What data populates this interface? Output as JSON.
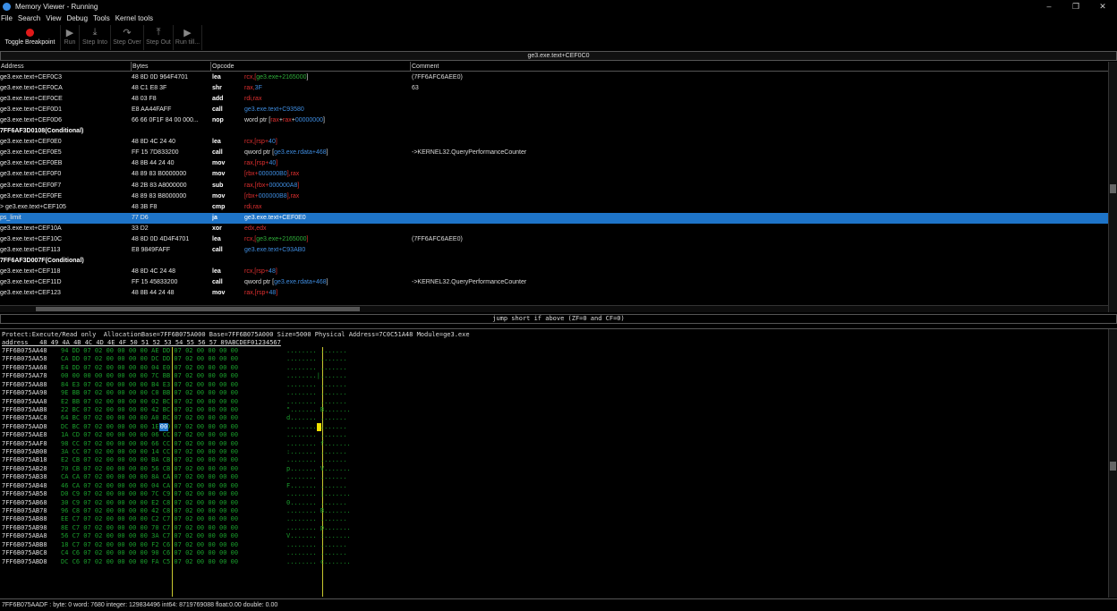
{
  "window": {
    "title": "Memory Viewer - Running",
    "minimize": "–",
    "restore": "❐",
    "close": "✕"
  },
  "menu": [
    "File",
    "Search",
    "View",
    "Debug",
    "Tools",
    "Kernel tools"
  ],
  "toolbar": [
    {
      "label": "Toggle Breakpoint",
      "icon": "breakpoint-icon",
      "glyph": ""
    },
    {
      "label": "Run",
      "icon": "run-icon",
      "glyph": "▶"
    },
    {
      "label": "Step Into",
      "icon": "step-into-icon",
      "glyph": "⤓"
    },
    {
      "label": "Step Over",
      "icon": "step-over-icon",
      "glyph": "↷"
    },
    {
      "label": "Step Out",
      "icon": "step-out-icon",
      "glyph": "⤒"
    },
    {
      "label": "Run till...",
      "icon": "run-till-icon",
      "glyph": "▶"
    }
  ],
  "disasm": {
    "title": "ge3.exe.text+CEF0C0",
    "headers": [
      "Address",
      "Bytes",
      "Opcode",
      "Comment"
    ],
    "rows": [
      {
        "type": "ins",
        "addr": "ge3.exe.text+CEF0C3",
        "bytes": "48 8D 0D 964F4701",
        "op": "lea",
        "args": [
          [
            "rcx,[",
            "reg"
          ],
          [
            "ge3.exe+2165000",
            "sym"
          ],
          [
            "]",
            "plain"
          ]
        ],
        "comment": "(7FF6AFC6AEE0)"
      },
      {
        "type": "ins",
        "addr": "ge3.exe.text+CEF0CA",
        "bytes": "48 C1 E8 3F",
        "op": "shr",
        "args": [
          [
            "rax,",
            "reg"
          ],
          [
            "3F",
            "num"
          ]
        ],
        "comment": "63"
      },
      {
        "type": "ins",
        "addr": "ge3.exe.text+CEF0CE",
        "bytes": "48 03 F8",
        "op": "add",
        "args": [
          [
            "rdi,rax",
            "reg"
          ]
        ],
        "comment": ""
      },
      {
        "type": "ins",
        "addr": "ge3.exe.text+CEF0D1",
        "bytes": "E8 AA44FAFF",
        "op": "call",
        "args": [
          [
            "ge3.exe.text+C93580",
            "num"
          ]
        ],
        "comment": ""
      },
      {
        "type": "ins",
        "addr": "ge3.exe.text+CEF0D6",
        "bytes": "66 66 0F1F 84 00 000...",
        "op": "nop",
        "args": [
          [
            "word ptr [",
            "plain"
          ],
          [
            "rax",
            "reg"
          ],
          [
            "+",
            "plain"
          ],
          [
            "rax",
            "reg"
          ],
          [
            "+",
            "plain"
          ],
          [
            "00000000",
            "num"
          ],
          [
            "]",
            "plain"
          ]
        ],
        "comment": ""
      },
      {
        "type": "label",
        "text": "7FF6AF3D0108(Conditional)"
      },
      {
        "type": "ins",
        "addr": "ge3.exe.text+CEF0E0",
        "bytes": "48 8D 4C 24 40",
        "op": "lea",
        "args": [
          [
            "rcx,[rsp+",
            "reg"
          ],
          [
            "40",
            "num"
          ],
          [
            "]",
            "reg"
          ]
        ],
        "comment": ""
      },
      {
        "type": "ins",
        "addr": "ge3.exe.text+CEF0E5",
        "bytes": "FF 15 7D833200",
        "op": "call",
        "args": [
          [
            "qword ptr [",
            "plain"
          ],
          [
            "ge3.exe.rdata+468",
            "num"
          ],
          [
            "]",
            "plain"
          ]
        ],
        "comment": "->KERNEL32.QueryPerformanceCounter"
      },
      {
        "type": "ins",
        "addr": "ge3.exe.text+CEF0EB",
        "bytes": "48 8B 44 24 40",
        "op": "mov",
        "args": [
          [
            "rax,[rsp+",
            "reg"
          ],
          [
            "40",
            "num"
          ],
          [
            "]",
            "reg"
          ]
        ],
        "comment": ""
      },
      {
        "type": "ins",
        "addr": "ge3.exe.text+CEF0F0",
        "bytes": "48 89 83 B0000000",
        "op": "mov",
        "args": [
          [
            "[rbx+",
            "reg"
          ],
          [
            "000000B0",
            "num"
          ],
          [
            "],rax",
            "reg"
          ]
        ],
        "comment": ""
      },
      {
        "type": "ins",
        "addr": "ge3.exe.text+CEF0F7",
        "bytes": "48 2B 83 A8000000",
        "op": "sub",
        "args": [
          [
            "rax,[rbx+",
            "reg"
          ],
          [
            "000000A8",
            "num"
          ],
          [
            "]",
            "reg"
          ]
        ],
        "comment": ""
      },
      {
        "type": "ins",
        "addr": "ge3.exe.text+CEF0FE",
        "bytes": "48 89 83 B8000000",
        "op": "mov",
        "args": [
          [
            "[rbx+",
            "reg"
          ],
          [
            "000000B8",
            "num"
          ],
          [
            "],rax",
            "reg"
          ]
        ],
        "comment": ""
      },
      {
        "type": "ins",
        "addr": "> ge3.exe.text+CEF105",
        "bytes": "48 3B F8",
        "op": "cmp",
        "args": [
          [
            "rdi,rax",
            "reg"
          ]
        ],
        "comment": ""
      },
      {
        "type": "ins",
        "sel": true,
        "addr": "ps_limit",
        "bytes": "77 D6",
        "op": "ja",
        "args": [
          [
            "ge3.exe.text+CEF0E0",
            "plain"
          ]
        ],
        "comment": ""
      },
      {
        "type": "ins",
        "addr": "ge3.exe.text+CEF10A",
        "bytes": "33 D2",
        "op": "xor",
        "args": [
          [
            "edx,edx",
            "reg"
          ]
        ],
        "comment": ""
      },
      {
        "type": "ins",
        "addr": "ge3.exe.text+CEF10C",
        "bytes": "48 8D 0D 4D4F4701",
        "op": "lea",
        "args": [
          [
            "rcx,[",
            "reg"
          ],
          [
            "ge3.exe+2165000",
            "sym"
          ],
          [
            "]",
            "reg"
          ]
        ],
        "comment": "(7FF6AFC6AEE0)"
      },
      {
        "type": "ins",
        "addr": "ge3.exe.text+CEF113",
        "bytes": "E8 9849FAFF",
        "op": "call",
        "args": [
          [
            "ge3.exe.text+C93AB0",
            "num"
          ]
        ],
        "comment": ""
      },
      {
        "type": "label",
        "text": "7FF6AF3D007F(Conditional)"
      },
      {
        "type": "ins",
        "addr": "ge3.exe.text+CEF118",
        "bytes": "48 8D 4C 24 48",
        "op": "lea",
        "args": [
          [
            "rcx,[rsp+",
            "reg"
          ],
          [
            "48",
            "num"
          ],
          [
            "]",
            "reg"
          ]
        ],
        "comment": ""
      },
      {
        "type": "ins",
        "addr": "ge3.exe.text+CEF11D",
        "bytes": "FF 15 45833200",
        "op": "call",
        "args": [
          [
            "qword ptr [",
            "plain"
          ],
          [
            "ge3.exe.rdata+468",
            "num"
          ],
          [
            "]",
            "plain"
          ]
        ],
        "comment": "->KERNEL32.QueryPerformanceCounter"
      },
      {
        "type": "ins",
        "addr": "ge3.exe.text+CEF123",
        "bytes": "48 8B 44 24 48",
        "op": "mov",
        "args": [
          [
            "rax,[rsp+",
            "reg"
          ],
          [
            "48",
            "num"
          ],
          [
            "]",
            "reg"
          ]
        ],
        "comment": ""
      }
    ]
  },
  "instruction_hint": "jump short if above (ZF=0 and CF=0)",
  "hex": {
    "info": "Protect:Execute/Read only  AllocationBase=7FF6B075A000 Base=7FF6B075A000 Size=5000 Physical Address=7C0C51A48 Module=ge3.exe",
    "header": "address   48 49 4A 4B 4C 4D 4E 4F 50 51 52 53 54 55 56 57 89ABCDEF01234567",
    "cursor_byte": "00",
    "rows": [
      {
        "addr": "7FF6B075AA48",
        "bytes": "94 DD 07 02 00 00 00 00 AE DD 07 02 00 00 00 00",
        "ascii": "........ ......."
      },
      {
        "addr": "7FF6B075AA58",
        "bytes": "CA DD 07 02 00 00 00 00 DC DD 07 02 00 00 00 00",
        "ascii": "........ ......."
      },
      {
        "addr": "7FF6B075AA68",
        "bytes": "E4 DD 07 02 00 00 00 00 04 E0 07 02 00 00 00 00",
        "ascii": "........ ......."
      },
      {
        "addr": "7FF6B075AA78",
        "bytes": "00 00 00 00 00 00 00 00 7C BB 07 02 00 00 00 00",
        "ascii": "........|......."
      },
      {
        "addr": "7FF6B075AA88",
        "bytes": "84 E3 07 02 00 00 00 00 B4 E3 07 02 00 00 00 00",
        "ascii": "........ ......."
      },
      {
        "addr": "7FF6B075AA98",
        "bytes": "9E BB 07 02 00 00 00 00 C0 BB 07 02 00 00 00 00",
        "ascii": "........ ......."
      },
      {
        "addr": "7FF6B075AAA8",
        "bytes": "E2 BB 07 02 00 00 00 00 02 BC 07 02 00 00 00 00",
        "ascii": "........ ......."
      },
      {
        "addr": "7FF6B075AAB8",
        "bytes": "22 BC 07 02 00 00 00 00 42 BC 07 02 00 00 00 00",
        "ascii": "\"....... B......."
      },
      {
        "addr": "7FF6B075AAC8",
        "bytes": "64 BC 07 02 00 00 00 00 A0 BC 07 02 00 00 00 00",
        "ascii": "d....... ......."
      },
      {
        "addr": "7FF6B075AAD8",
        "bytes": "DC BC 07 02 00 00 00 00 1E BD 07 02 00 00 00 00",
        "ascii": "........ ......."
      },
      {
        "addr": "7FF6B075AAE8",
        "bytes": "1A CD 07 02 00 00 00 00 06 CC 07 02 00 00 00 00",
        "ascii": "........ ......."
      },
      {
        "addr": "7FF6B075AAF8",
        "bytes": "98 CC 07 02 00 00 00 00 66 CC 07 02 00 00 00 00",
        "ascii": "........ f......."
      },
      {
        "addr": "7FF6B075AB08",
        "bytes": "3A CC 07 02 00 00 00 00 14 CC 07 02 00 00 00 00",
        "ascii": ":....... ......."
      },
      {
        "addr": "7FF6B075AB18",
        "bytes": "E2 CB 07 02 00 00 00 00 BA CB 07 02 00 00 00 00",
        "ascii": "........ ......."
      },
      {
        "addr": "7FF6B075AB28",
        "bytes": "70 CB 07 02 00 00 00 00 56 CB 07 02 00 00 00 00",
        "ascii": "p....... V......."
      },
      {
        "addr": "7FF6B075AB38",
        "bytes": "CA CA 07 02 00 00 00 00 8A CA 07 02 00 00 00 00",
        "ascii": "........ ......."
      },
      {
        "addr": "7FF6B075AB48",
        "bytes": "46 CA 07 02 00 00 00 00 04 CA 07 02 00 00 00 00",
        "ascii": "F....... ......."
      },
      {
        "addr": "7FF6B075AB58",
        "bytes": "D0 C9 07 02 00 00 00 00 7C C9 07 02 00 00 00 00",
        "ascii": "........ |......."
      },
      {
        "addr": "7FF6B075AB68",
        "bytes": "30 C9 07 02 00 00 00 00 E2 C8 07 02 00 00 00 00",
        "ascii": "0....... ......."
      },
      {
        "addr": "7FF6B075AB78",
        "bytes": "96 C8 07 02 00 00 00 00 42 C8 07 02 00 00 00 00",
        "ascii": "........ B......."
      },
      {
        "addr": "7FF6B075AB88",
        "bytes": "EE C7 07 02 00 00 00 00 C2 C7 07 02 00 00 00 00",
        "ascii": "........ ......."
      },
      {
        "addr": "7FF6B075AB98",
        "bytes": "8E C7 07 02 00 00 00 00 70 C7 07 02 00 00 00 00",
        "ascii": "........ p......."
      },
      {
        "addr": "7FF6B075ABA8",
        "bytes": "56 C7 07 02 00 00 00 00 3A C7 07 02 00 00 00 00",
        "ascii": "V....... :......."
      },
      {
        "addr": "7FF6B075ABB8",
        "bytes": "18 C7 07 02 00 00 00 00 F2 C6 07 02 00 00 00 00",
        "ascii": "........ ......."
      },
      {
        "addr": "7FF6B075ABC8",
        "bytes": "C4 C6 07 02 00 00 00 00 90 C6 07 02 00 00 00 00",
        "ascii": "........ ......."
      },
      {
        "addr": "7FF6B075ABD8",
        "bytes": "DC C6 07 02 00 00 00 00 FA C5 07 02 00 00 00 00",
        "ascii": "........ c......."
      }
    ]
  },
  "bottom_status": "7FF6B075AADF : byte: 0 word: 7680 integer: 129834496 int64: 8719769088 float:0.00 double: 0.00"
}
